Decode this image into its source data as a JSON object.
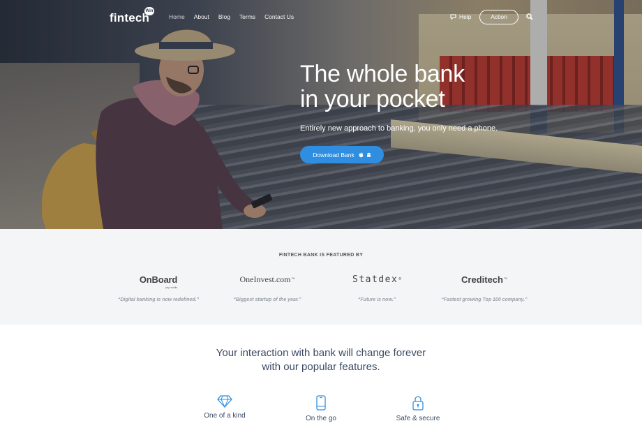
{
  "nav": {
    "logo": "fintech",
    "logo_badge": "Win",
    "menu": [
      "Home",
      "About",
      "Blog",
      "Terms",
      "Contact Us"
    ],
    "help": "Help",
    "action": "Action"
  },
  "hero": {
    "title_line1": "The whole bank",
    "title_line2": "in your pocket",
    "subtitle": "Entirely new approach to banking, you only need a phone.",
    "download_label": "Download Bank"
  },
  "featured": {
    "title": "FINTECH BANK IS FEATURED BY",
    "brands": [
      {
        "name": "OnBoard",
        "sub": "pay mobile",
        "quote": "“Digital banking is now redefined.”"
      },
      {
        "name": "OneInvest.com",
        "tm": "™",
        "quote": "“Biggest startup of the year.”"
      },
      {
        "name": "Statdex",
        "tm": "®",
        "quote": "“Future is now.”"
      },
      {
        "name": "Creditech",
        "tm": "™",
        "quote": "“Fastest growing Top 100 company.”"
      }
    ]
  },
  "interaction": {
    "heading_line1": "Your interaction with bank will change forever",
    "heading_line2": "with our popular features."
  },
  "features": [
    {
      "label": "One of a kind",
      "icon": "diamond-icon"
    },
    {
      "label": "On the go",
      "icon": "phone-icon"
    },
    {
      "label": "Safe & secure",
      "icon": "lock-icon"
    }
  ],
  "colors": {
    "accent": "#2f8ee0",
    "heading": "#3c4a63",
    "featured_bg": "#f4f5f7"
  }
}
